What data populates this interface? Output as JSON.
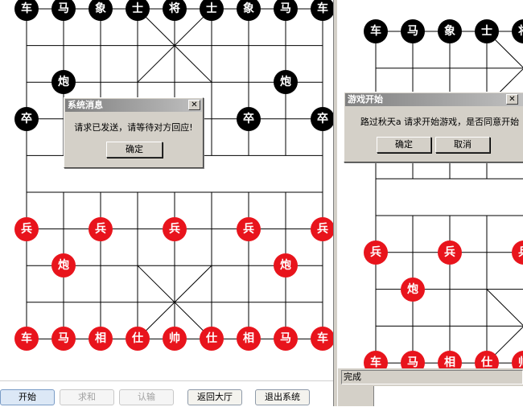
{
  "left_board": {
    "pieces": [
      {
        "label": "车",
        "side": "black",
        "col": 0,
        "row": 0
      },
      {
        "label": "马",
        "side": "black",
        "col": 1,
        "row": 0
      },
      {
        "label": "象",
        "side": "black",
        "col": 2,
        "row": 0
      },
      {
        "label": "士",
        "side": "black",
        "col": 3,
        "row": 0
      },
      {
        "label": "将",
        "side": "black",
        "col": 4,
        "row": 0
      },
      {
        "label": "士",
        "side": "black",
        "col": 5,
        "row": 0
      },
      {
        "label": "象",
        "side": "black",
        "col": 6,
        "row": 0
      },
      {
        "label": "马",
        "side": "black",
        "col": 7,
        "row": 0
      },
      {
        "label": "车",
        "side": "black",
        "col": 8,
        "row": 0
      },
      {
        "label": "炮",
        "side": "black",
        "col": 1,
        "row": 2
      },
      {
        "label": "炮",
        "side": "black",
        "col": 7,
        "row": 2
      },
      {
        "label": "卒",
        "side": "black",
        "col": 0,
        "row": 3
      },
      {
        "label": "卒",
        "side": "black",
        "col": 6,
        "row": 3
      },
      {
        "label": "卒",
        "side": "black",
        "col": 8,
        "row": 3
      },
      {
        "label": "兵",
        "side": "red",
        "col": 0,
        "row": 6
      },
      {
        "label": "兵",
        "side": "red",
        "col": 2,
        "row": 6
      },
      {
        "label": "兵",
        "side": "red",
        "col": 4,
        "row": 6
      },
      {
        "label": "兵",
        "side": "red",
        "col": 6,
        "row": 6
      },
      {
        "label": "兵",
        "side": "red",
        "col": 8,
        "row": 6
      },
      {
        "label": "炮",
        "side": "red",
        "col": 1,
        "row": 7
      },
      {
        "label": "炮",
        "side": "red",
        "col": 7,
        "row": 7
      },
      {
        "label": "车",
        "side": "red",
        "col": 0,
        "row": 9
      },
      {
        "label": "马",
        "side": "red",
        "col": 1,
        "row": 9
      },
      {
        "label": "相",
        "side": "red",
        "col": 2,
        "row": 9
      },
      {
        "label": "仕",
        "side": "red",
        "col": 3,
        "row": 9
      },
      {
        "label": "帅",
        "side": "red",
        "col": 4,
        "row": 9
      },
      {
        "label": "仕",
        "side": "red",
        "col": 5,
        "row": 9
      },
      {
        "label": "相",
        "side": "red",
        "col": 6,
        "row": 9
      },
      {
        "label": "马",
        "side": "red",
        "col": 7,
        "row": 9
      },
      {
        "label": "车",
        "side": "red",
        "col": 8,
        "row": 9
      }
    ]
  },
  "right_board": {
    "pieces": [
      {
        "label": "车",
        "side": "black",
        "col": 0,
        "row": 0
      },
      {
        "label": "马",
        "side": "black",
        "col": 1,
        "row": 0
      },
      {
        "label": "象",
        "side": "black",
        "col": 2,
        "row": 0
      },
      {
        "label": "士",
        "side": "black",
        "col": 3,
        "row": 0
      },
      {
        "label": "将",
        "side": "black",
        "col": 4,
        "row": 0
      },
      {
        "label": "兵",
        "side": "red",
        "col": 0,
        "row": 6
      },
      {
        "label": "兵",
        "side": "red",
        "col": 2,
        "row": 6
      },
      {
        "label": "兵",
        "side": "red",
        "col": 4,
        "row": 6
      },
      {
        "label": "炮",
        "side": "red",
        "col": 1,
        "row": 7
      },
      {
        "label": "车",
        "side": "red",
        "col": 0,
        "row": 9
      },
      {
        "label": "马",
        "side": "red",
        "col": 1,
        "row": 9
      },
      {
        "label": "相",
        "side": "red",
        "col": 2,
        "row": 9
      },
      {
        "label": "仕",
        "side": "red",
        "col": 3,
        "row": 9
      },
      {
        "label": "帅",
        "side": "red",
        "col": 4,
        "row": 9
      }
    ]
  },
  "dialog_system": {
    "title": "系统消息",
    "close": "✕",
    "message": "请求已发送，请等待对方回应!",
    "ok": "确定"
  },
  "dialog_game_start": {
    "title": "游戏开始",
    "close": "✕",
    "message": "路过秋天a 请求开始游戏，是否同意开始",
    "ok": "确定",
    "cancel": "取消"
  },
  "toolbar": {
    "start": "开始",
    "draw": "求和",
    "resign": "认输",
    "lobby": "返回大厅",
    "exit": "退出系统"
  },
  "status": {
    "text": "完成"
  },
  "colors": {
    "black_piece": "#000000",
    "red_piece": "#e8141c",
    "dialog_bg": "#d4d0c8"
  }
}
